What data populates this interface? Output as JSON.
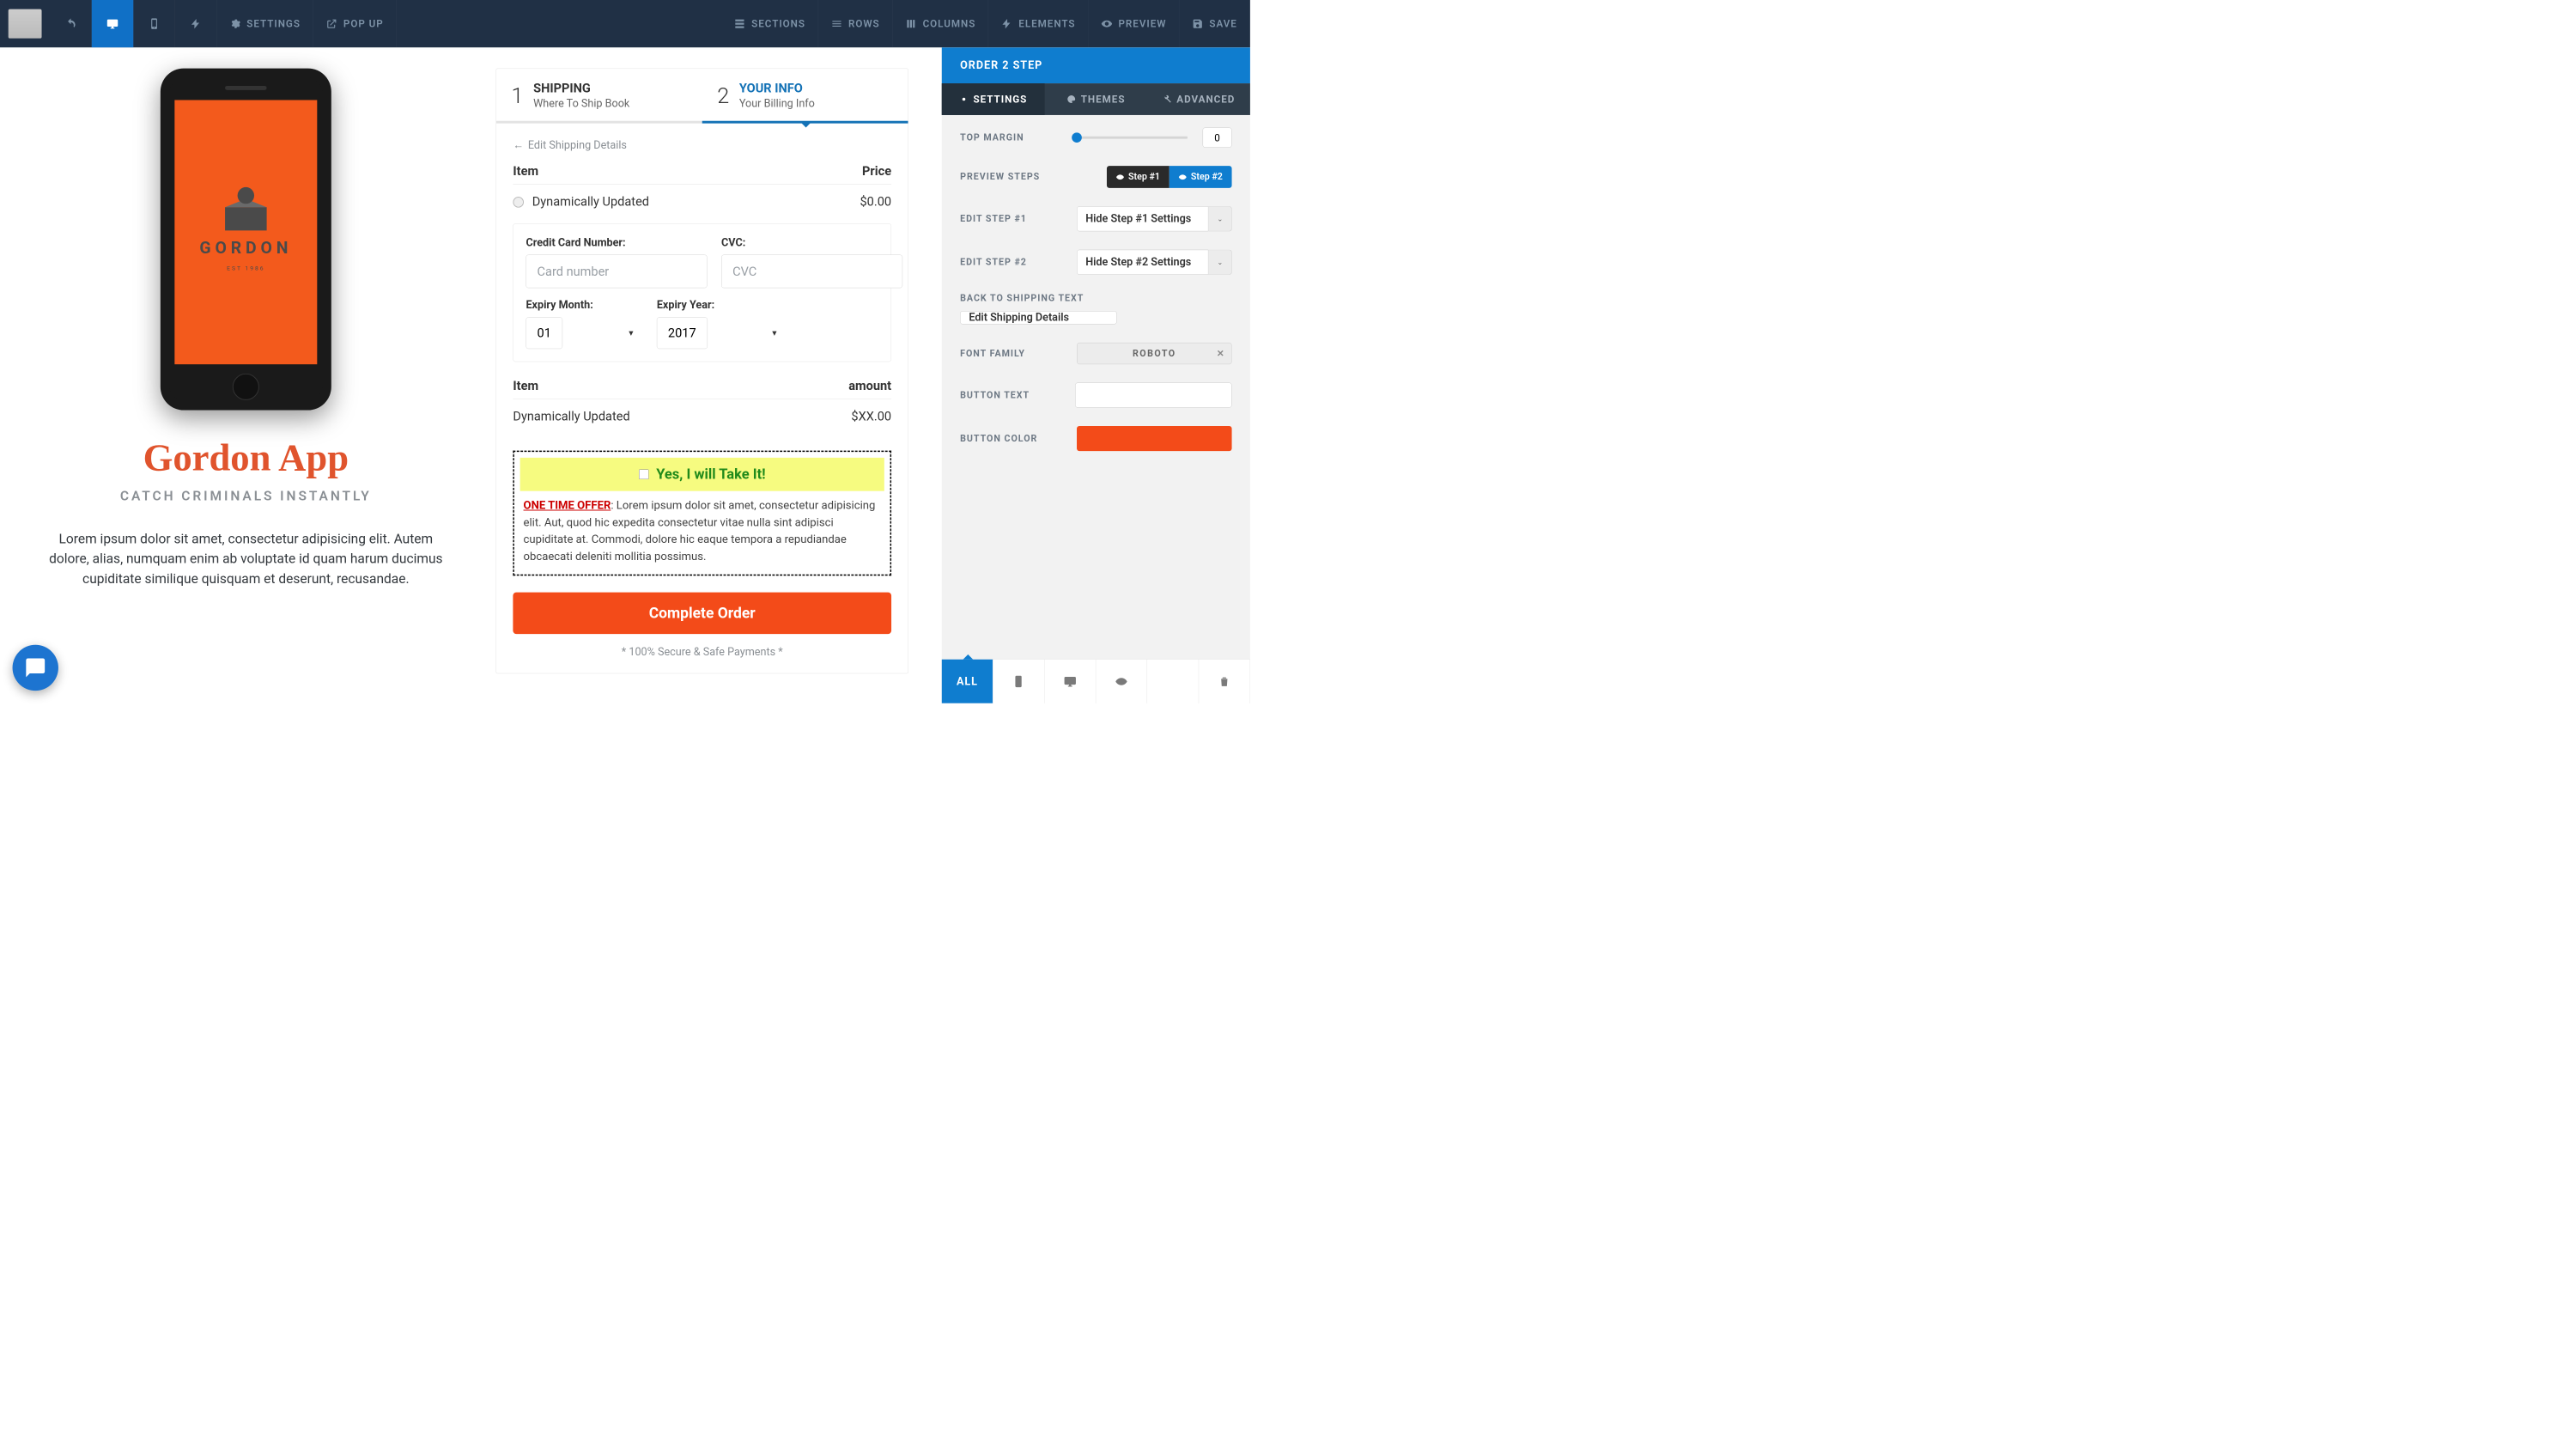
{
  "topbar": {
    "settings": "SETTINGS",
    "popup": "POP UP",
    "sections": "SECTIONS",
    "rows": "ROWS",
    "columns": "COLUMNS",
    "elements": "ELEMENTS",
    "preview": "PREVIEW",
    "save": "SAVE"
  },
  "product": {
    "brand": "GORDON",
    "est": "EST 1986",
    "title": "Gordon App",
    "subtitle": "CATCH CRIMINALS INSTANTLY",
    "body": "Lorem ipsum dolor sit amet, consectetur adipisicing elit. Autem dolore, alias, numquam enim ab voluptate id quam harum ducimus cupiditate similique quisquam et deserunt, recusandae."
  },
  "order": {
    "step1": {
      "num": "1",
      "title": "SHIPPING",
      "sub": "Where To Ship Book"
    },
    "step2": {
      "num": "2",
      "title": "YOUR INFO",
      "sub": "Your Billing Info"
    },
    "back": "Edit Shipping Details",
    "item_h": "Item",
    "price_h": "Price",
    "item1": "Dynamically Updated",
    "price1": "$0.00",
    "cc": {
      "num_l": "Credit Card Number:",
      "num_ph": "Card number",
      "cvc_l": "CVC:",
      "cvc_ph": "CVC",
      "month_l": "Expiry Month:",
      "month_v": "01",
      "year_l": "Expiry Year:",
      "year_v": "2017"
    },
    "item2_h": "Item",
    "amount_h": "amount",
    "item2": "Dynamically Updated",
    "amount2": "$XX.00",
    "bump_cta": "Yes, I will Take It!",
    "bump_label": "ONE TIME OFFER",
    "bump_body": ": Lorem ipsum dolor sit amet, consectetur adipisicing elit. Aut, quod hic expedita consectetur vitae nulla sint adipisci cupiditate at. Commodi, dolore hic eaque tempora a repudiandae obcaecati deleniti mollitia possimus.",
    "complete": "Complete Order",
    "secure": "* 100% Secure & Safe Payments *"
  },
  "panel": {
    "title": "ORDER 2 STEP",
    "tab_settings": "SETTINGS",
    "tab_themes": "THEMES",
    "tab_advanced": "ADVANCED",
    "top_margin_l": "TOP MARGIN",
    "top_margin_v": "0",
    "preview_steps_l": "PREVIEW STEPS",
    "seg1": "Step #1",
    "seg2": "Step #2",
    "edit1_l": "EDIT STEP #1",
    "edit1_v": "Hide Step #1 Settings",
    "edit2_l": "EDIT STEP #2",
    "edit2_v": "Hide Step #2 Settings",
    "back_l": "BACK TO SHIPPING TEXT",
    "back_v": "Edit Shipping Details",
    "font_l": "FONT FAMILY",
    "font_v": "ROBOTO",
    "btn_text_l": "BUTTON TEXT",
    "btn_text_v": "",
    "btn_color_l": "BUTTON COLOR",
    "btn_color_v": "#f34b19",
    "footer_all": "ALL"
  }
}
